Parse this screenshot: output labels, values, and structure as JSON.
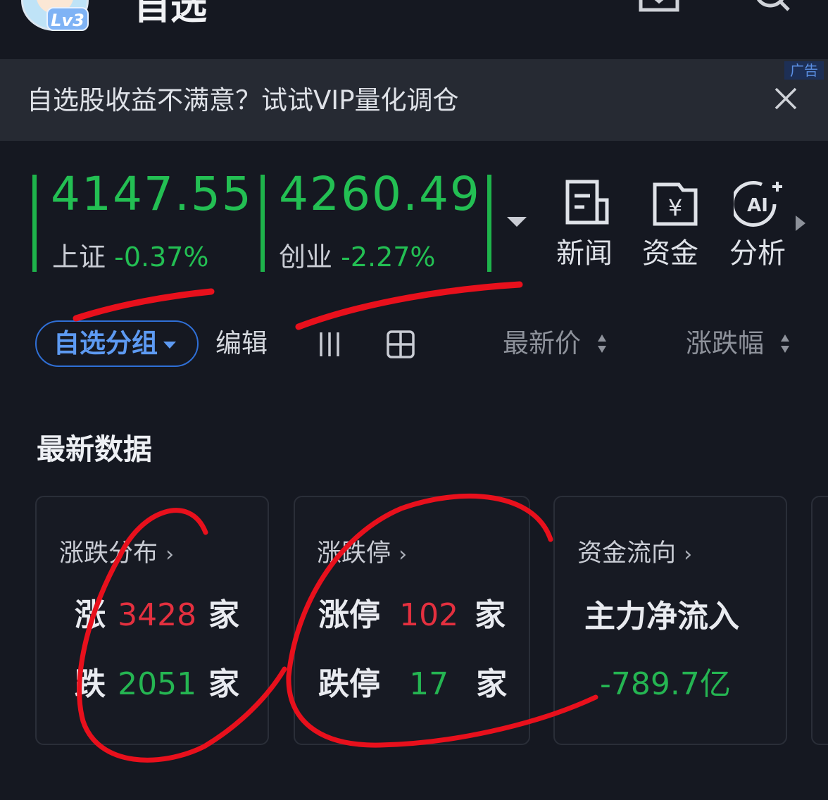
{
  "header": {
    "title": "自选",
    "level_badge": "Lv3",
    "icons": [
      "message-icon",
      "search-icon"
    ]
  },
  "ad": {
    "tag": "广告",
    "text": "自选股收益不满意？试试VIP量化调仓"
  },
  "indices": [
    {
      "value": "4147.55",
      "name": "上证",
      "change": "-0.37%"
    },
    {
      "value": "4260.49",
      "name": "创业",
      "change": "-2.27%"
    }
  ],
  "quick_links": [
    {
      "label": "新闻",
      "icon": "news-icon"
    },
    {
      "label": "资金",
      "icon": "fund-icon"
    },
    {
      "label": "分析",
      "icon": "ai-analysis-icon"
    }
  ],
  "toolbar": {
    "group_label": "自选分组",
    "edit_label": "编辑",
    "sort_price": "最新价",
    "sort_change": "涨跌幅"
  },
  "section_title": "最新数据",
  "cards": {
    "distribution": {
      "title": "涨跌分布",
      "up_label": "涨",
      "up_count": "3428",
      "up_unit": "家",
      "down_label": "跌",
      "down_count": "2051",
      "down_unit": "家"
    },
    "limit": {
      "title": "涨跌停",
      "up_label": "涨停",
      "up_count": "102",
      "up_unit": "家",
      "down_label": "跌停",
      "down_count": "17",
      "down_unit": "家"
    },
    "flow": {
      "title": "资金流向",
      "label": "主力净流入",
      "value": "-789.7亿"
    }
  },
  "colors": {
    "background": "#151821",
    "up_red": "#e4303f",
    "down_green": "#25b552",
    "accent_blue": "#2f6fd6",
    "annotation_red": "#e8101c"
  }
}
